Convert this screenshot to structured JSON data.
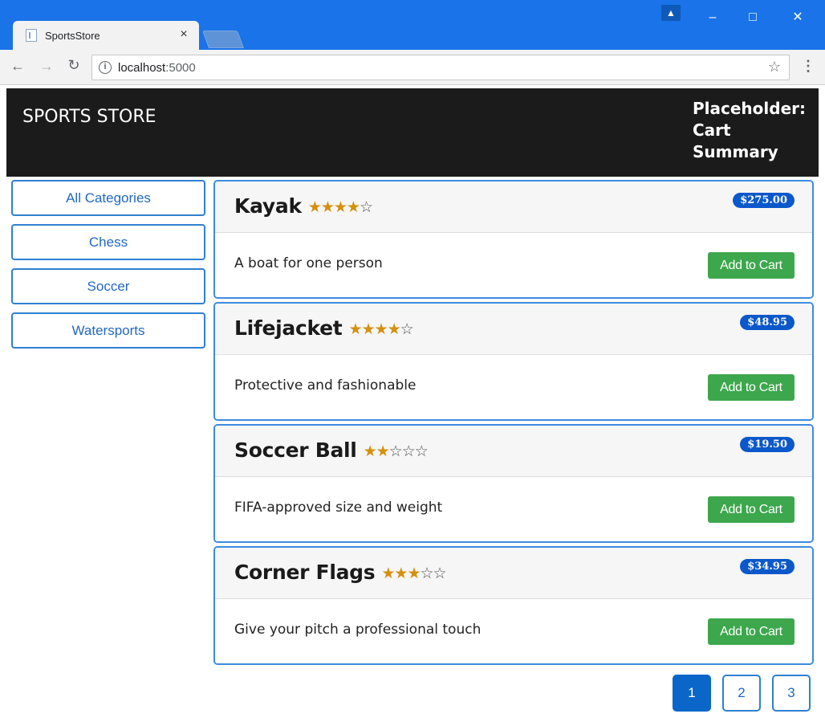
{
  "browser": {
    "tab_title": "SportsStore",
    "tab_close": "×",
    "url_host": "localhost",
    "url_port": ":5000",
    "icons": [
      "back-arrow-icon",
      "forward-arrow-icon",
      "reload-icon",
      "info-icon",
      "star-icon",
      "menu-dots-icon",
      "profile-icon",
      "minimize-icon",
      "maximize-icon",
      "close-icon"
    ]
  },
  "navbar": {
    "brand": "SPORTS STORE",
    "cart_summary_line1": "Placeholder:",
    "cart_summary_line2": "Cart",
    "cart_summary_line3": "Summary"
  },
  "categories": [
    {
      "label": "All Categories"
    },
    {
      "label": "Chess"
    },
    {
      "label": "Soccer"
    },
    {
      "label": "Watersports"
    }
  ],
  "products": [
    {
      "name": "Kayak",
      "rating": 4,
      "max_rating": 5,
      "price": "$275.00",
      "description": "A boat for one person",
      "button": "Add to Cart"
    },
    {
      "name": "Lifejacket",
      "rating": 4,
      "max_rating": 5,
      "price": "$48.95",
      "description": "Protective and fashionable",
      "button": "Add to Cart"
    },
    {
      "name": "Soccer Ball",
      "rating": 2,
      "max_rating": 5,
      "price": "$19.50",
      "description": "FIFA-approved size and weight",
      "button": "Add to Cart"
    },
    {
      "name": "Corner Flags",
      "rating": 3,
      "max_rating": 5,
      "price": "$34.95",
      "description": "Give your pitch a professional touch",
      "button": "Add to Cart"
    }
  ],
  "pagination": {
    "pages": [
      "1",
      "2",
      "3"
    ],
    "active": "1"
  },
  "colors": {
    "titlebar": "#1a73e8",
    "navbar": "#1b1b1b",
    "accent": "#2f80d0",
    "price_badge": "#0a58ca",
    "add_button": "#3da74d",
    "star": "#d4900e"
  }
}
